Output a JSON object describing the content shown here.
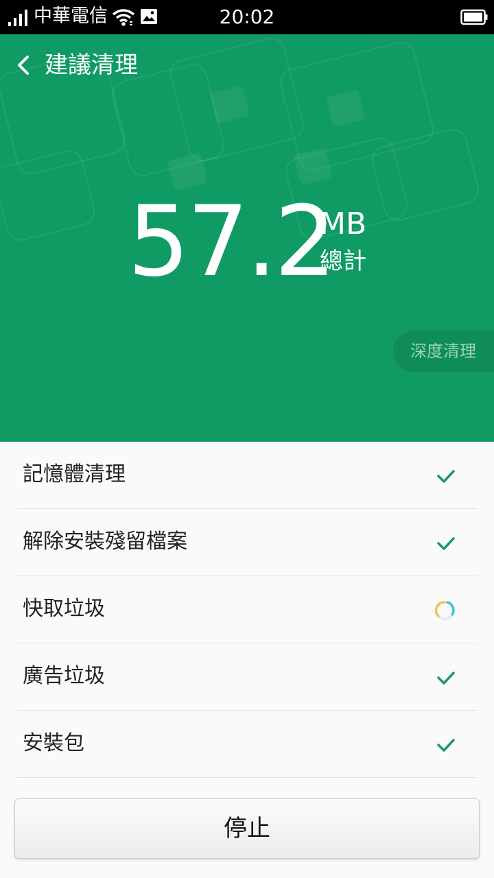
{
  "status_bar": {
    "carrier": "中華電信",
    "time": "20:02"
  },
  "header": {
    "title": "建議清理",
    "amount": "57.2",
    "unit": "MB",
    "total_label": "總計",
    "deep_clean_label": "深度清理"
  },
  "items": [
    {
      "label": "記憶體清理",
      "status": "done"
    },
    {
      "label": "解除安裝殘留檔案",
      "status": "done"
    },
    {
      "label": "快取垃圾",
      "status": "scanning"
    },
    {
      "label": "廣告垃圾",
      "status": "done"
    },
    {
      "label": "安裝包",
      "status": "done"
    }
  ],
  "stop_label": "停止",
  "colors": {
    "accent": "#119b64",
    "check": "#1a9a66"
  }
}
